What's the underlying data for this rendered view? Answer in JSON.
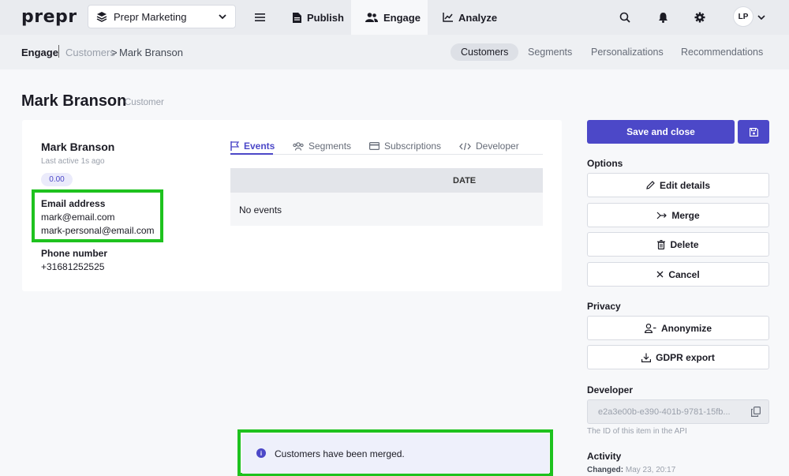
{
  "app": {
    "logo": "prepr"
  },
  "topbar": {
    "workspace": "Prepr Marketing",
    "nav": {
      "publish": "Publish",
      "engage": "Engage",
      "analyze": "Analyze"
    },
    "avatar_initials": "LP"
  },
  "breadcrumb": {
    "root": "Engage",
    "link": "Customers",
    "sep": ">",
    "current": "Mark Branson"
  },
  "subnav": {
    "tabs": [
      "Customers",
      "Segments",
      "Personalizations",
      "Recommendations"
    ],
    "active": "Customers"
  },
  "page": {
    "title": "Mark Branson",
    "subtitle": "Customer"
  },
  "customer": {
    "name": "Mark Branson",
    "last_active": "Last active 1s ago",
    "score": "0.00",
    "email_label": "Email address",
    "emails": [
      "mark@email.com",
      "mark-personal@email.com"
    ],
    "phone_label": "Phone number",
    "phone": "+31681252525"
  },
  "tabs": {
    "events": "Events",
    "segments": "Segments",
    "subscriptions": "Subscriptions",
    "developer": "Developer"
  },
  "events_table": {
    "columns": [
      "DATE"
    ],
    "empty": "No events"
  },
  "actions": {
    "save_close": "Save and close",
    "options_label": "Options",
    "edit": "Edit details",
    "merge": "Merge",
    "delete": "Delete",
    "cancel": "Cancel",
    "privacy_label": "Privacy",
    "anonymize": "Anonymize",
    "gdpr": "GDPR export",
    "developer_label": "Developer",
    "id_value": "e2a3e00b-e390-401b-9781-15fb...",
    "id_help": "The ID of this item in the API",
    "activity_label": "Activity",
    "changed_label": "Changed:",
    "changed_value": "May 23, 20:17"
  },
  "toast": {
    "message": "Customers have been merged.",
    "icon": "i"
  },
  "colors": {
    "primary": "#4c48c8",
    "highlight": "#1ec21e"
  }
}
